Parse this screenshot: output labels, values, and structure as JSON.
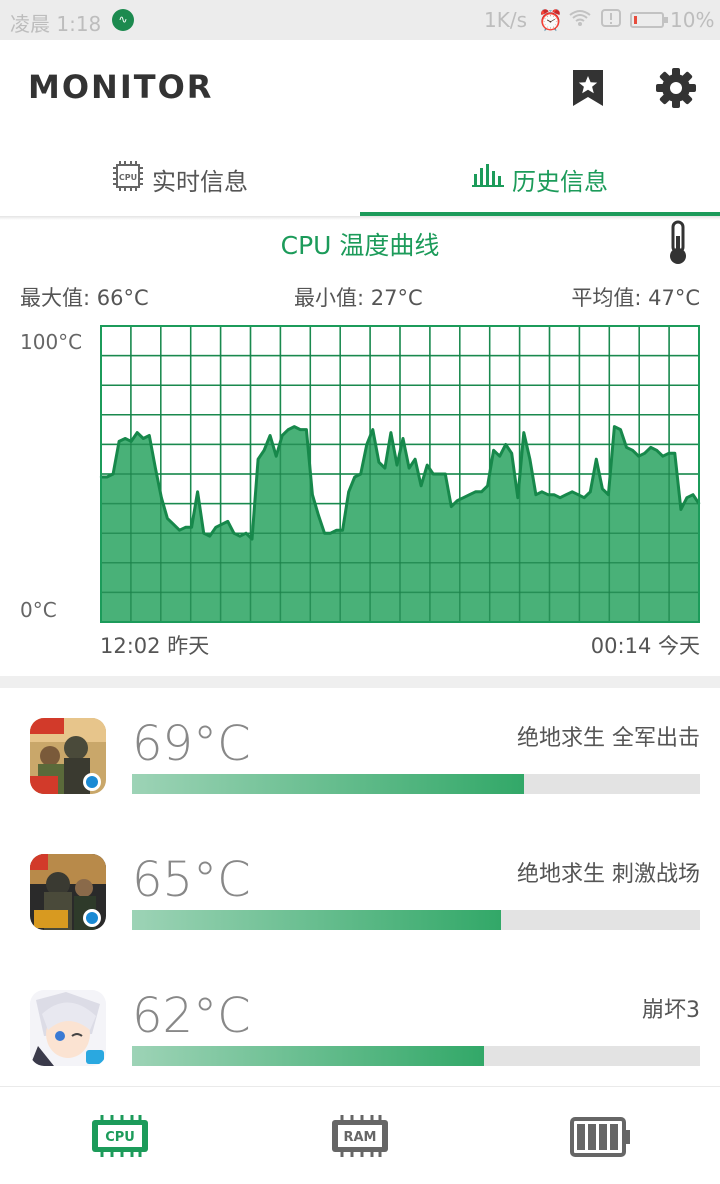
{
  "status_bar": {
    "time": "凌晨 1:18",
    "net_speed": "1K/s",
    "battery_pct": "10%",
    "battery_level": 0.1
  },
  "app": {
    "title": "MONITOR"
  },
  "tabs": [
    {
      "label": "实时信息",
      "icon": "cpu-chip-icon",
      "selected": false
    },
    {
      "label": "历史信息",
      "icon": "bar-chart-icon",
      "selected": true
    }
  ],
  "chart_section": {
    "title": "CPU 温度曲线",
    "stats": {
      "max": "最大值: 66°C",
      "min": "最小值: 27°C",
      "avg": "平均值: 47°C"
    }
  },
  "chart_data": {
    "type": "area",
    "ylim": [
      0,
      100
    ],
    "ytick_labels": [
      "100°C",
      "0°C"
    ],
    "x_start_label": "12:02 昨天",
    "x_end_label": "00:14 今天",
    "grid": true,
    "color": "#1c9b5a",
    "values": [
      49,
      49,
      50,
      61,
      62,
      61,
      64,
      62,
      63,
      52,
      42,
      35,
      33,
      31,
      32,
      32,
      44,
      30,
      29,
      32,
      33,
      34,
      30,
      29,
      30,
      28,
      55,
      58,
      63,
      56,
      63,
      65,
      66,
      65,
      65,
      43,
      36,
      30,
      30,
      31,
      31,
      44,
      49,
      50,
      60,
      65,
      54,
      52,
      64,
      53,
      62,
      52,
      55,
      46,
      53,
      50,
      50,
      50,
      39,
      41,
      42,
      43,
      44,
      44,
      46,
      58,
      56,
      60,
      57,
      42,
      64,
      55,
      43,
      44,
      43,
      43,
      42,
      43,
      44,
      43,
      42,
      44,
      55,
      45,
      43,
      66,
      65,
      59,
      58,
      56,
      57,
      59,
      58,
      56,
      57,
      57,
      38,
      42,
      43,
      40
    ]
  },
  "app_list": [
    {
      "name": "绝地求生 全军出击",
      "temp": "69°C",
      "value": 69,
      "icon": "pubg-quanjun-app-icon"
    },
    {
      "name": "绝地求生 刺激战场",
      "temp": "65°C",
      "value": 65,
      "icon": "pubg-ciji-app-icon"
    },
    {
      "name": "崩坏3",
      "temp": "62°C",
      "value": 62,
      "icon": "honkai3-app-icon"
    }
  ],
  "bottom_nav": [
    {
      "icon": "cpu-icon",
      "label": "CPU",
      "active": true
    },
    {
      "icon": "ram-icon",
      "label": "RAM",
      "active": false
    },
    {
      "icon": "battery-icon",
      "active": false
    }
  ]
}
